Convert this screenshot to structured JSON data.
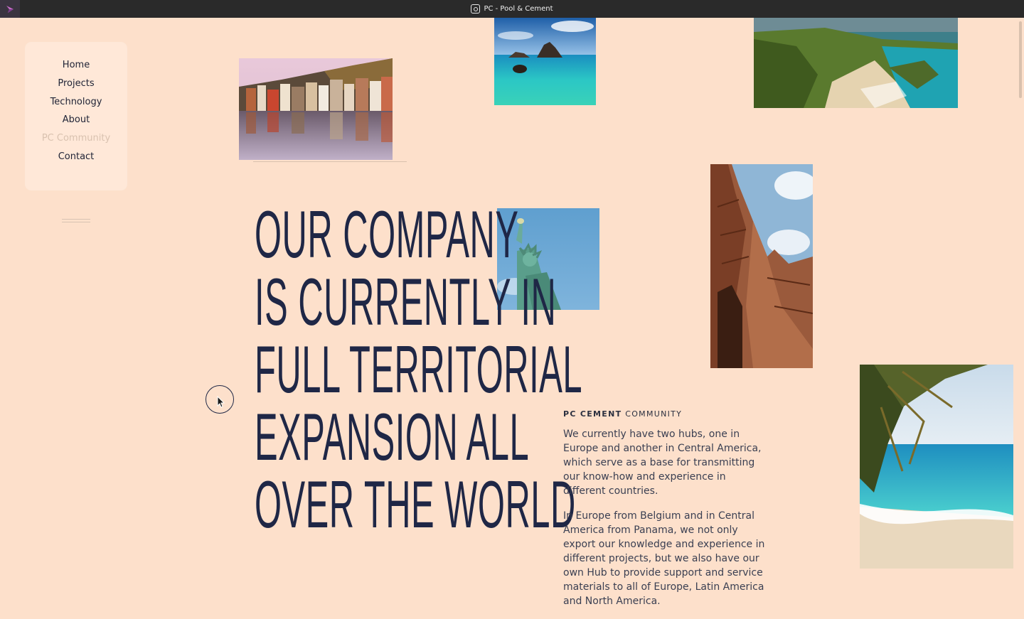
{
  "window": {
    "title": "PC - Pool & Cement"
  },
  "nav": {
    "items": [
      {
        "label": "Home",
        "active": false
      },
      {
        "label": "Projects",
        "active": false
      },
      {
        "label": "Technology",
        "active": false
      },
      {
        "label": "About",
        "active": false
      },
      {
        "label": "PC Community",
        "active": true
      },
      {
        "label": "Contact",
        "active": false
      }
    ]
  },
  "headline": {
    "lines": [
      "OUR COMPANY",
      "IS CURRENTLY IN",
      "FULL TERRITORIAL",
      "EXPANSION ALL",
      "OVER THE WORLD"
    ]
  },
  "community": {
    "kicker_bold": "PC CEMENT",
    "kicker_rest": " COMMUNITY",
    "p1": "We currently have two hubs, one in Europe and another in Central America, which serve as a base for transmitting our know-how and experience in different countries.",
    "p2": "In Europe from Belgium and in Central America from Panama, we not only export our knowledge and experience in different projects, but we also have our own Hub to provide support and service materials to all of Europe, Latin America and North America."
  },
  "colors": {
    "background": "#fde0cb",
    "ink": "#1f2746",
    "muted": "#d9c2b0"
  }
}
